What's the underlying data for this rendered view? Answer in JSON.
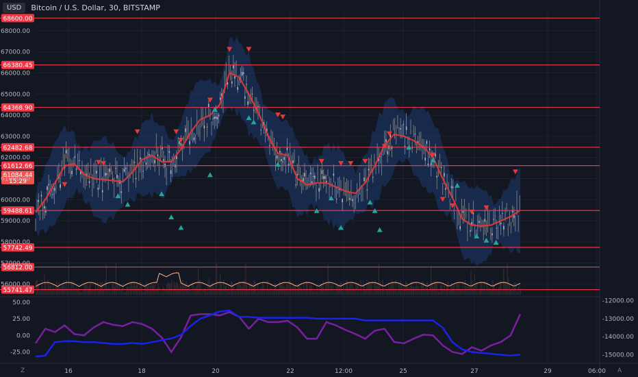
{
  "header": {
    "currency_badge": "USD",
    "title": "Bitcoin / U.S. Dollar, 30, BITSTAMP"
  },
  "footer": {
    "zoom_label": "Z",
    "auto_label": "A"
  },
  "colors": {
    "background": "#131722",
    "level_line": "#f23645",
    "ma_line": "#e53935",
    "band_fill": "#1e3a6e",
    "candle": "#8a8d93",
    "sell_marker": "#e53935",
    "buy_marker": "#26a69a",
    "osc_purple": "#7b1fa2",
    "osc_blue": "#1a23e8",
    "volume_ma": "#ffb38a"
  },
  "chart_data": [
    {
      "type": "line",
      "title": "Bitcoin / U.S. Dollar, 30, BITSTAMP",
      "x_ticks": [
        "16",
        "18",
        "20",
        "22",
        "12:00",
        "25",
        "27",
        "29",
        "06:00"
      ],
      "y_ticks": [
        56000,
        57000,
        58000,
        59000,
        60000,
        61000,
        62000,
        63000,
        64000,
        65000,
        66000,
        67000,
        68000
      ],
      "ylim": [
        55500,
        69000
      ],
      "grid": true,
      "horizontal_levels": [
        68600.0,
        66380.45,
        64368.9,
        62482.68,
        61612.66,
        59488.61,
        57742.49,
        56812.0,
        55741.47
      ],
      "level_labels": [
        "68600.00",
        "66380.45",
        "64368.90",
        "62482.68",
        "61612.66",
        "59488.61",
        "57742.49",
        "56812.00",
        "55741.47"
      ],
      "current_price": {
        "value": 61084.44,
        "label": "61084.44",
        "countdown": "15:29"
      },
      "series": [
        {
          "x": [
            0,
            2,
            4,
            6,
            8,
            10,
            12,
            14,
            16,
            18,
            20,
            22,
            24,
            26,
            28,
            30,
            32,
            34,
            36,
            38,
            40,
            42,
            44,
            46,
            48,
            50,
            52,
            54,
            56,
            58,
            60,
            62,
            64,
            66,
            68,
            70,
            72,
            74,
            76,
            78,
            80,
            82,
            84,
            86,
            88,
            90,
            92,
            94,
            96,
            98,
            100
          ],
          "values": [
            59400,
            60000,
            60800,
            61600,
            61700,
            61200,
            61000,
            60950,
            60900,
            60850,
            61300,
            61900,
            62100,
            61800,
            61800,
            62400,
            63200,
            63800,
            64000,
            64500,
            66000,
            65800,
            65000,
            64100,
            63000,
            62200,
            62100,
            61000,
            60700,
            60800,
            60800,
            60600,
            60400,
            60300,
            60800,
            61600,
            62600,
            63100,
            63000,
            62800,
            62500,
            62000,
            61000,
            60100,
            59100,
            58800,
            58750,
            58800,
            59000,
            59200,
            59500
          ]
        }
      ],
      "sell_markers": [
        {
          "x": 6,
          "y": 60700
        },
        {
          "x": 13,
          "y": 61750
        },
        {
          "x": 14,
          "y": 61700
        },
        {
          "x": 21,
          "y": 63200
        },
        {
          "x": 29,
          "y": 63200
        },
        {
          "x": 30,
          "y": 62800
        },
        {
          "x": 36,
          "y": 64700
        },
        {
          "x": 40,
          "y": 67100
        },
        {
          "x": 44,
          "y": 67100
        },
        {
          "x": 50,
          "y": 64000
        },
        {
          "x": 51,
          "y": 63900
        },
        {
          "x": 59,
          "y": 61800
        },
        {
          "x": 63,
          "y": 61700
        },
        {
          "x": 65,
          "y": 61700
        },
        {
          "x": 68,
          "y": 61800
        },
        {
          "x": 72,
          "y": 62500
        },
        {
          "x": 73,
          "y": 63100
        },
        {
          "x": 82,
          "y": 62100
        },
        {
          "x": 84,
          "y": 60000
        },
        {
          "x": 86,
          "y": 59700
        },
        {
          "x": 90,
          "y": 59400
        },
        {
          "x": 93,
          "y": 59600
        },
        {
          "x": 99,
          "y": 61300
        }
      ],
      "buy_markers": [
        {
          "x": 17,
          "y": 60200
        },
        {
          "x": 19,
          "y": 59800
        },
        {
          "x": 26,
          "y": 60300
        },
        {
          "x": 28,
          "y": 59200
        },
        {
          "x": 30,
          "y": 58700
        },
        {
          "x": 36,
          "y": 61200
        },
        {
          "x": 37,
          "y": 64300
        },
        {
          "x": 44,
          "y": 63900
        },
        {
          "x": 45,
          "y": 63700
        },
        {
          "x": 50,
          "y": 61700
        },
        {
          "x": 58,
          "y": 59500
        },
        {
          "x": 61,
          "y": 60100
        },
        {
          "x": 63,
          "y": 58700
        },
        {
          "x": 69,
          "y": 59900
        },
        {
          "x": 70,
          "y": 59500
        },
        {
          "x": 71,
          "y": 58600
        },
        {
          "x": 77,
          "y": 62500
        },
        {
          "x": 82,
          "y": 61900
        },
        {
          "x": 87,
          "y": 60700
        },
        {
          "x": 91,
          "y": 58300
        },
        {
          "x": 93,
          "y": 58100
        },
        {
          "x": 95,
          "y": 58000
        }
      ]
    },
    {
      "type": "line",
      "left_ticks": [
        50.0,
        25.0,
        0.0,
        -25.0
      ],
      "left_tick_labels": [
        "50.00",
        "25.00",
        "0.00",
        "-25.00"
      ],
      "left_ylim": [
        -40,
        55
      ],
      "right_ticks": [
        -12000,
        -13000,
        -14000,
        -15000
      ],
      "right_tick_labels": [
        "-12000.00",
        "-13000.00",
        "-14000.00",
        "-15000.00"
      ],
      "right_ylim": [
        -15400,
        -11900
      ],
      "series": [
        {
          "axis": "left",
          "x": [
            0,
            2,
            4,
            6,
            8,
            10,
            12,
            14,
            16,
            18,
            20,
            22,
            24,
            26,
            28,
            30,
            32,
            34,
            36,
            38,
            40,
            42,
            44,
            46,
            48,
            50,
            52,
            54,
            56,
            58,
            60,
            62,
            64,
            66,
            68,
            70,
            72,
            74,
            76,
            78,
            80,
            82,
            84,
            86,
            88,
            90,
            92,
            94,
            96,
            98,
            100
          ],
          "values": [
            -12,
            10,
            5,
            15,
            2,
            0,
            12,
            20,
            16,
            14,
            20,
            17,
            10,
            -3,
            -25,
            -3,
            30,
            32,
            32,
            30,
            35,
            28,
            10,
            25,
            20,
            20,
            22,
            12,
            -5,
            -5,
            20,
            15,
            8,
            2,
            -5,
            7,
            10,
            -10,
            -12,
            -5,
            1,
            0,
            -15,
            -25,
            -28,
            -18,
            -23,
            -15,
            -10,
            0,
            32
          ]
        },
        {
          "axis": "right",
          "x": [
            0,
            2,
            4,
            6,
            8,
            10,
            12,
            14,
            16,
            18,
            20,
            22,
            24,
            26,
            28,
            30,
            32,
            34,
            36,
            38,
            40,
            42,
            44,
            46,
            48,
            50,
            52,
            54,
            56,
            58,
            60,
            62,
            64,
            66,
            68,
            70,
            72,
            74,
            76,
            78,
            80,
            82,
            84,
            86,
            88,
            90,
            92,
            94,
            96,
            98,
            100
          ],
          "values": [
            -15100,
            -15050,
            -14300,
            -14250,
            -14250,
            -14300,
            -14300,
            -14350,
            -14400,
            -14400,
            -14350,
            -14400,
            -14300,
            -14200,
            -14100,
            -13900,
            -13400,
            -13000,
            -12800,
            -12600,
            -12550,
            -12900,
            -12900,
            -12950,
            -12950,
            -12950,
            -12950,
            -12950,
            -12950,
            -13000,
            -13000,
            -13000,
            -13000,
            -13000,
            -13100,
            -13100,
            -13100,
            -13100,
            -13100,
            -13100,
            -13100,
            -13100,
            -13500,
            -14300,
            -14700,
            -14850,
            -14900,
            -14950,
            -15000,
            -15050,
            -15000
          ]
        }
      ]
    }
  ]
}
